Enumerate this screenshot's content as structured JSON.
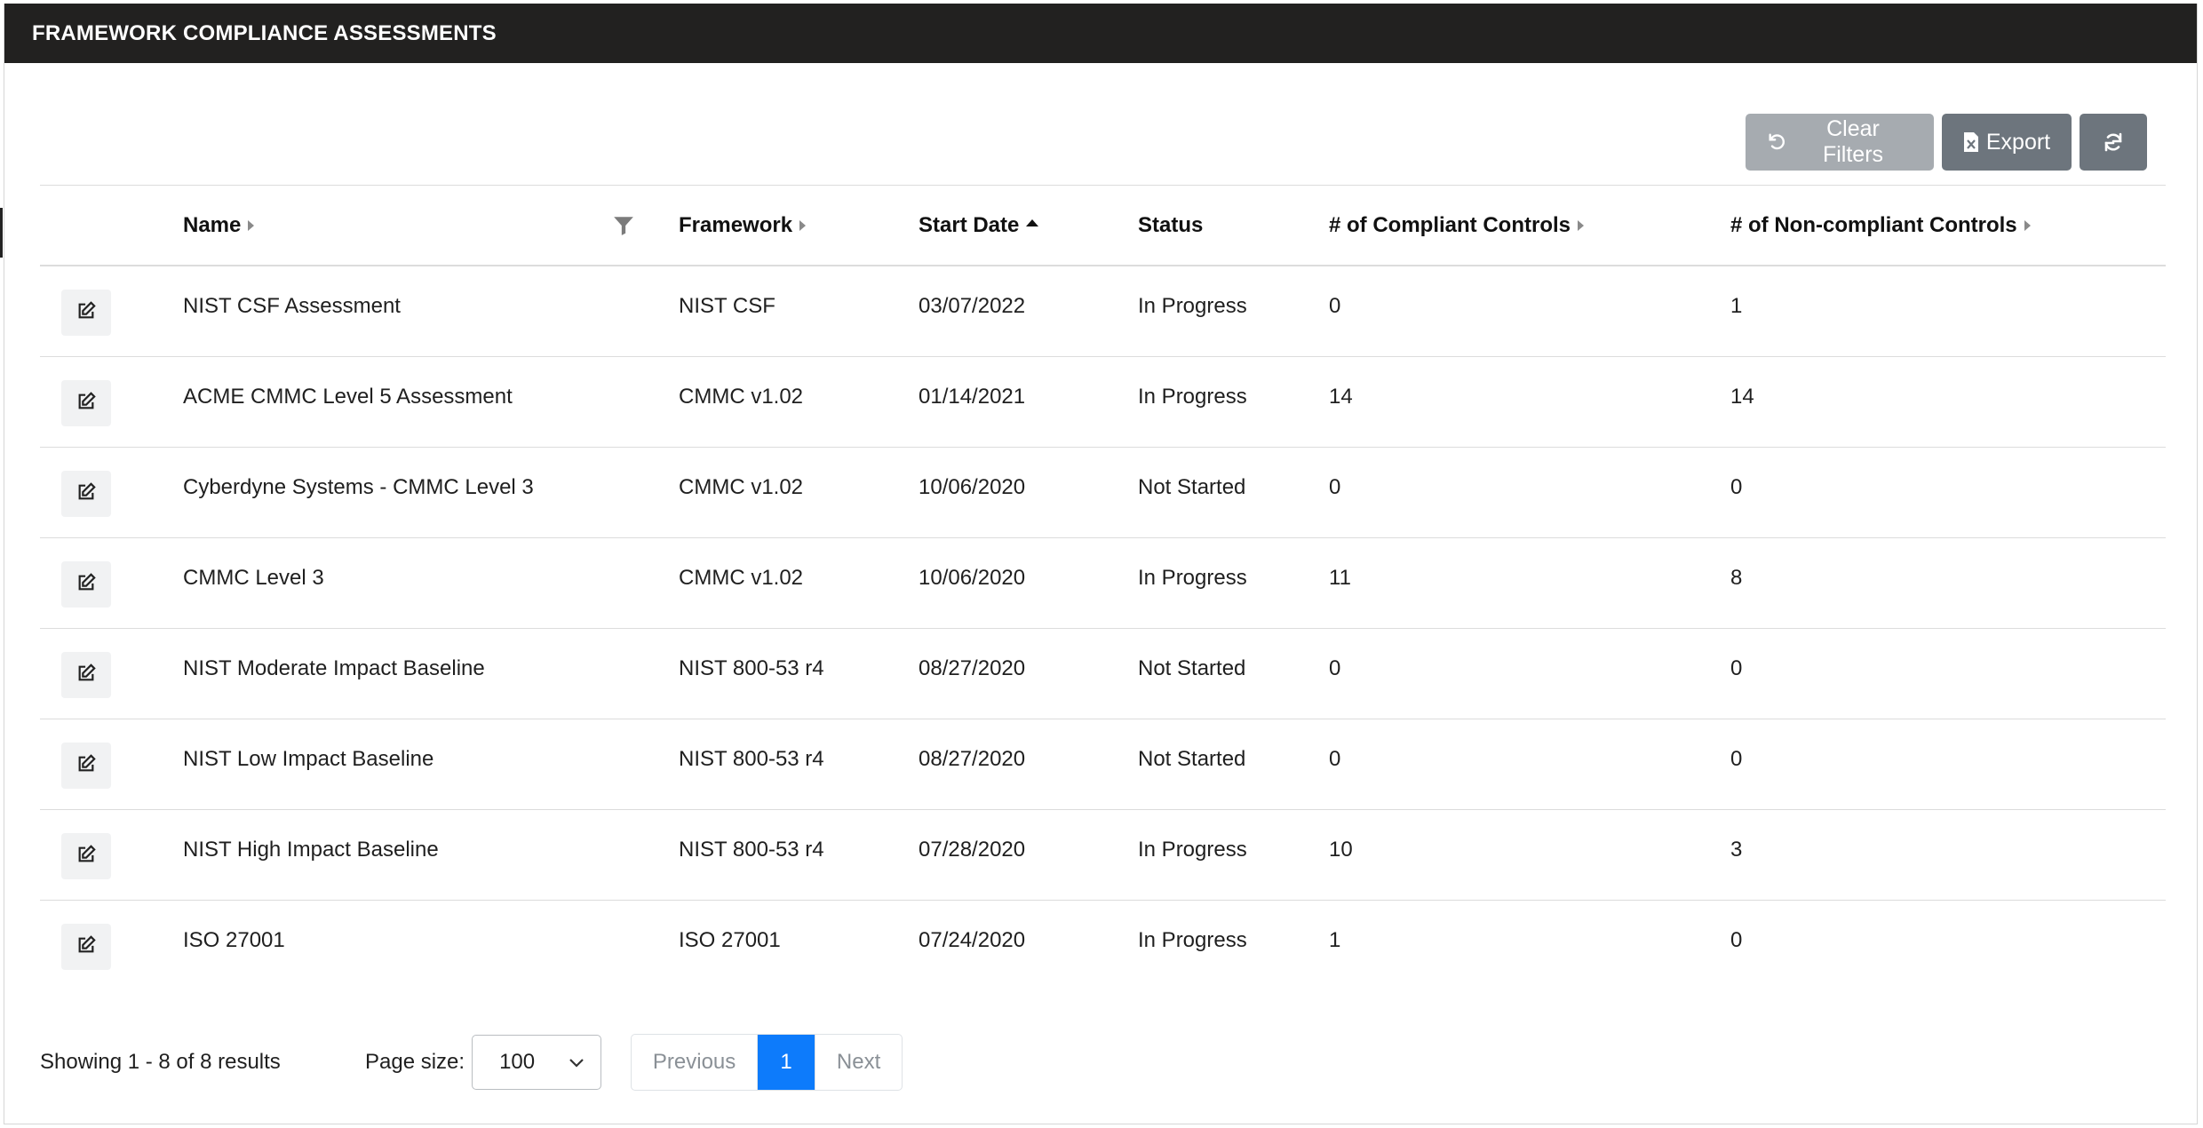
{
  "header": {
    "title": "FRAMEWORK COMPLIANCE ASSESSMENTS"
  },
  "toolbar": {
    "clear_filters_label": "Clear Filters",
    "export_label": "Export",
    "refresh_icon": "refresh-icon",
    "undo_icon": "undo-icon",
    "excel_icon": "excel-file-icon"
  },
  "table": {
    "columns": {
      "name": "Name",
      "framework": "Framework",
      "start_date": "Start Date",
      "status": "Status",
      "compliant": "# of Compliant Controls",
      "noncompliant": "# of Non-compliant Controls"
    },
    "sort": {
      "column": "start_date",
      "direction": "ascending"
    },
    "rows": [
      {
        "name": "NIST CSF Assessment",
        "framework": "NIST CSF",
        "start_date": "03/07/2022",
        "status": "In Progress",
        "compliant": "0",
        "noncompliant": "1"
      },
      {
        "name": "ACME CMMC Level 5 Assessment",
        "framework": "CMMC v1.02",
        "start_date": "01/14/2021",
        "status": "In Progress",
        "compliant": "14",
        "noncompliant": "14"
      },
      {
        "name": "Cyberdyne Systems - CMMC Level 3",
        "framework": "CMMC v1.02",
        "start_date": "10/06/2020",
        "status": "Not Started",
        "compliant": "0",
        "noncompliant": "0"
      },
      {
        "name": "CMMC Level 3",
        "framework": "CMMC v1.02",
        "start_date": "10/06/2020",
        "status": "In Progress",
        "compliant": "11",
        "noncompliant": "8"
      },
      {
        "name": "NIST Moderate Impact Baseline",
        "framework": "NIST 800-53 r4",
        "start_date": "08/27/2020",
        "status": "Not Started",
        "compliant": "0",
        "noncompliant": "0"
      },
      {
        "name": "NIST Low Impact Baseline",
        "framework": "NIST 800-53 r4",
        "start_date": "08/27/2020",
        "status": "Not Started",
        "compliant": "0",
        "noncompliant": "0"
      },
      {
        "name": "NIST High Impact Baseline",
        "framework": "NIST 800-53 r4",
        "start_date": "07/28/2020",
        "status": "In Progress",
        "compliant": "10",
        "noncompliant": "3"
      },
      {
        "name": "ISO 27001",
        "framework": "ISO 27001",
        "start_date": "07/24/2020",
        "status": "In Progress",
        "compliant": "1",
        "noncompliant": "0"
      }
    ]
  },
  "footer": {
    "showing": "Showing 1 - 8 of 8 results",
    "page_size_label": "Page size:",
    "page_size_value": "100",
    "previous_label": "Previous",
    "current_page": "1",
    "next_label": "Next"
  },
  "colors": {
    "header_bg": "#222120",
    "button_gray": "#6d757d",
    "button_disabled": "#a6abb0",
    "active_page": "#0d7bfb"
  }
}
